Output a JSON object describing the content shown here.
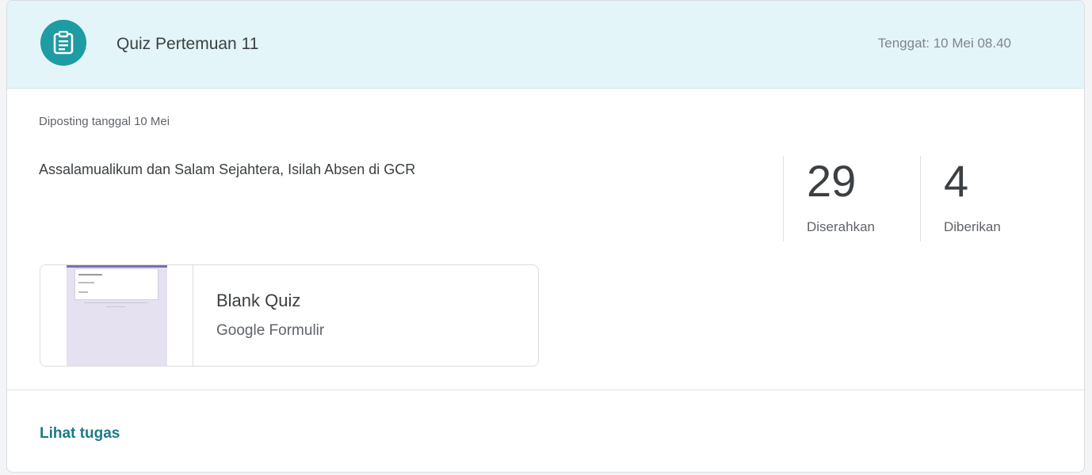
{
  "assignment": {
    "title": "Quiz Pertemuan 11",
    "due": "Tenggat: 10 Mei 08.40",
    "posted": "Diposting tanggal 10 Mei",
    "description": "Assalamualikum dan Salam Sejahtera, Isilah Absen di GCR",
    "icon": "assignment-icon",
    "accent_color": "#1e9ba3",
    "header_color": "#e3f5f8"
  },
  "stats": {
    "submitted": {
      "value": "29",
      "label": "Diserahkan"
    },
    "assigned": {
      "value": "4",
      "label": "Diberikan"
    }
  },
  "attachment": {
    "title": "Blank Quiz",
    "type": "Google Formulir",
    "thumb_color": "#e5e1f1"
  },
  "footer": {
    "link": "Lihat tugas",
    "link_color": "#1a7b85"
  }
}
